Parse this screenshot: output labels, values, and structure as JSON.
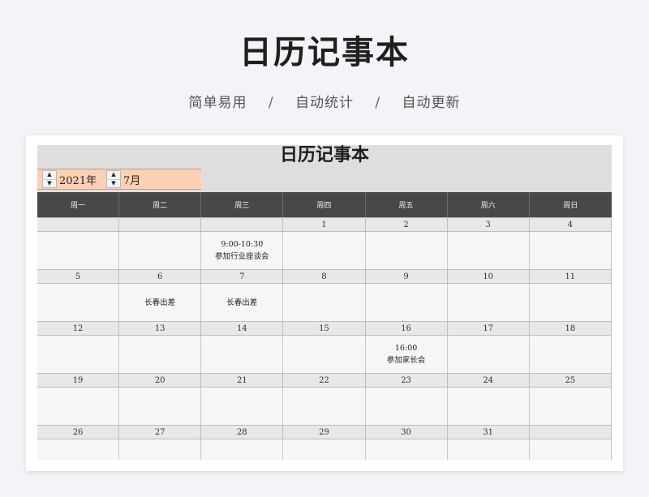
{
  "page": {
    "title": "日历记事本",
    "features": [
      "简单易用",
      "自动统计",
      "自动更新"
    ],
    "separator": "/"
  },
  "sheet": {
    "title": "日历记事本",
    "year_label": "2021年",
    "month_label": "7月",
    "weekdays": [
      "周一",
      "周二",
      "周三",
      "周四",
      "周五",
      "周六",
      "周日"
    ],
    "weeks": [
      {
        "dates": [
          "",
          "",
          "",
          "1",
          "2",
          "3",
          "4"
        ],
        "events": [
          "",
          "",
          "9:00-10:30\n参加行业座谈会",
          "",
          "",
          "",
          ""
        ]
      },
      {
        "dates": [
          "5",
          "6",
          "7",
          "8",
          "9",
          "10",
          "11"
        ],
        "events": [
          "",
          "长春出差",
          "长春出差",
          "",
          "",
          "",
          ""
        ]
      },
      {
        "dates": [
          "12",
          "13",
          "14",
          "15",
          "16",
          "17",
          "18"
        ],
        "events": [
          "",
          "",
          "",
          "",
          "16:00\n参加家长会",
          "",
          ""
        ]
      },
      {
        "dates": [
          "19",
          "20",
          "21",
          "22",
          "23",
          "24",
          "25"
        ],
        "events": [
          "",
          "",
          "",
          "",
          "",
          "",
          ""
        ]
      },
      {
        "dates": [
          "26",
          "27",
          "28",
          "29",
          "30",
          "31",
          ""
        ],
        "events": [
          "",
          "",
          "",
          "",
          "",
          "",
          ""
        ]
      }
    ]
  },
  "colors": {
    "header_bg": "#484848",
    "picker_bg": "#fcd0b4",
    "sheet_title_bg": "#dedede"
  }
}
